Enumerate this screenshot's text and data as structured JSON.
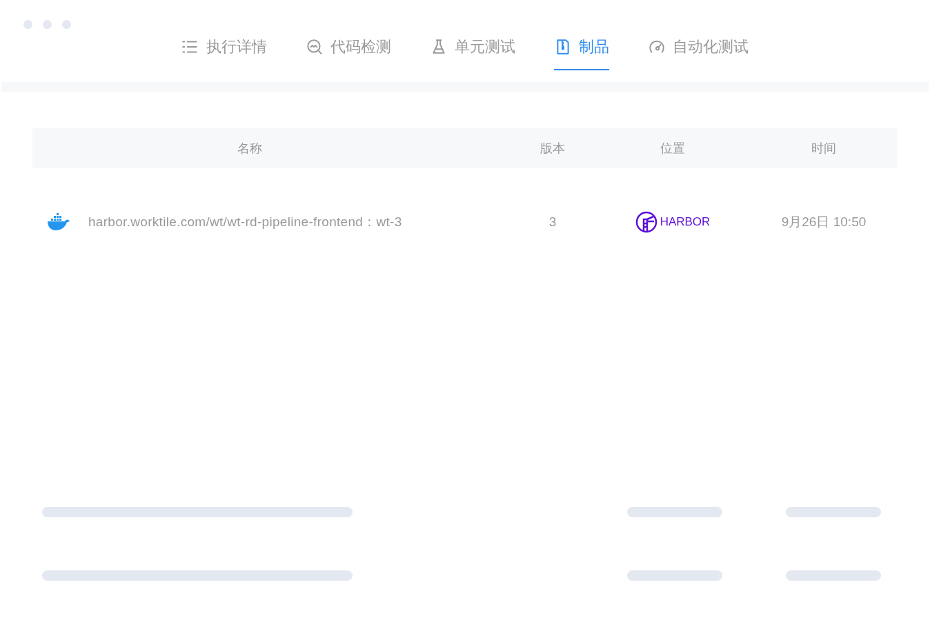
{
  "tabs": [
    {
      "label": "执行详情",
      "kind": "list",
      "selected": false
    },
    {
      "label": "代码检测",
      "kind": "scan",
      "selected": false
    },
    {
      "label": "单元测试",
      "kind": "flask",
      "selected": false
    },
    {
      "label": "制品",
      "kind": "package",
      "selected": true
    },
    {
      "label": "自动化测试",
      "kind": "gauge",
      "selected": false
    }
  ],
  "table": {
    "columns": [
      "名称",
      "版本",
      "位置",
      "时间"
    ],
    "rows": [
      {
        "name": "harbor.worktile.com/wt/wt-rd-pipeline-frontend：wt-3",
        "version": "3",
        "location": "HARBOR",
        "time": "9月26日 10:50"
      }
    ]
  }
}
